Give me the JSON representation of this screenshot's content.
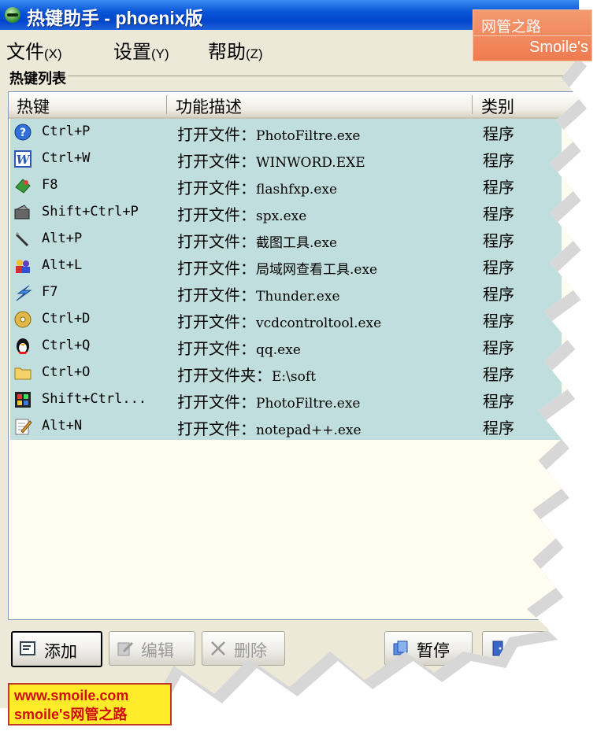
{
  "window": {
    "title": "热键助手 - phoenix版"
  },
  "logo": {
    "line1": "网管之路",
    "line2": "Smoile's"
  },
  "menu": {
    "items": [
      {
        "label": "文件",
        "accel": "(X)"
      },
      {
        "label": "设置",
        "accel": "(Y)"
      },
      {
        "label": "帮助",
        "accel": "(Z)"
      }
    ]
  },
  "group": {
    "label": "热键列表"
  },
  "list": {
    "columns": [
      "热键",
      "功能描述",
      "类别"
    ],
    "rows": [
      {
        "icon": "help-circle-icon",
        "key": "Ctrl+P",
        "desc_prefix": "打开文件：",
        "desc_name": "PhotoFiltre.exe",
        "type": "程序"
      },
      {
        "icon": "word-icon",
        "key": "Ctrl+W",
        "desc_prefix": "打开文件：",
        "desc_name": "WINWORD.EXE",
        "type": "程序"
      },
      {
        "icon": "flashfxp-icon",
        "key": "F8",
        "desc_prefix": "打开文件：",
        "desc_name": "flashfxp.exe",
        "type": "程序"
      },
      {
        "icon": "spx-icon",
        "key": "Shift+Ctrl+P",
        "desc_prefix": "打开文件：",
        "desc_name": "spx.exe",
        "type": "程序"
      },
      {
        "icon": "pen-icon",
        "key": "Alt+P",
        "desc_prefix": "打开文件：",
        "desc_name": "截图工具.exe",
        "type": "程序"
      },
      {
        "icon": "network-users-icon",
        "key": "Alt+L",
        "desc_prefix": "打开文件：",
        "desc_name": "局域网查看工具.exe",
        "type": "程序"
      },
      {
        "icon": "thunder-icon",
        "key": "F7",
        "desc_prefix": "打开文件：",
        "desc_name": "Thunder.exe",
        "type": "程序"
      },
      {
        "icon": "cd-icon",
        "key": "Ctrl+D",
        "desc_prefix": "打开文件：",
        "desc_name": "vcdcontroltool.exe",
        "type": "程序"
      },
      {
        "icon": "qq-penguin-icon",
        "key": "Ctrl+Q",
        "desc_prefix": "打开文件：",
        "desc_name": "qq.exe",
        "type": "程序"
      },
      {
        "icon": "folder-icon",
        "key": "Ctrl+O",
        "desc_prefix": "打开文件夹：",
        "desc_name": "E:\\soft",
        "type": "程序"
      },
      {
        "icon": "film-icon",
        "key": "Shift+Ctrl...",
        "desc_prefix": "打开文件：",
        "desc_name": "PhotoFiltre.exe",
        "type": "程序"
      },
      {
        "icon": "notepad-icon",
        "key": "Alt+N",
        "desc_prefix": "打开文件：",
        "desc_name": "notepad++.exe",
        "type": "程序"
      }
    ]
  },
  "buttons": {
    "add": "添加",
    "edit": "编辑",
    "delete": "删除",
    "pause": "暂停",
    "exit": ""
  },
  "watermark": {
    "line1": "www.smoile.com",
    "line2": "smoile's网管之路"
  },
  "colors": {
    "titlebar": "#0a55d8",
    "row_highlight": "#c1dede",
    "list_bg": "#fffdf0",
    "window_bg": "#ece9d8"
  }
}
